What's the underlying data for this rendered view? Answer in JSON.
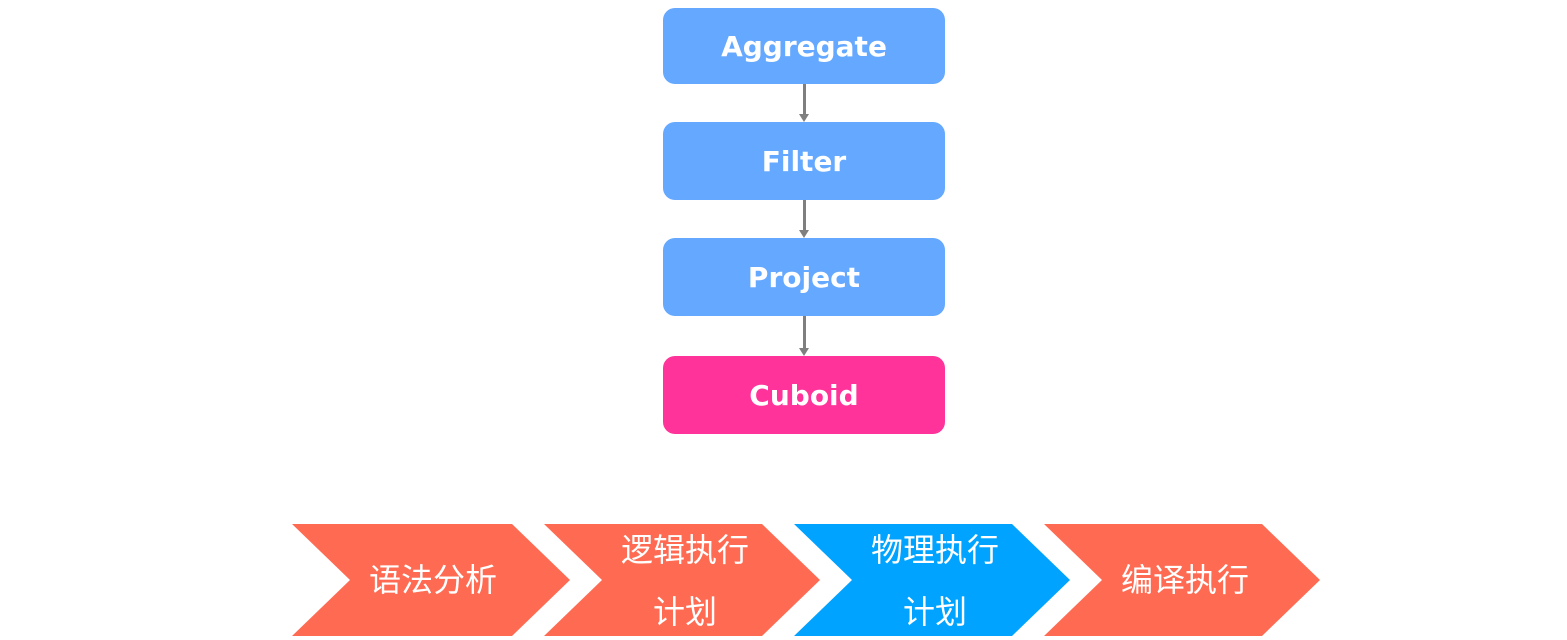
{
  "flow": {
    "nodes": [
      {
        "label": "Aggregate",
        "color": "#64A8FF"
      },
      {
        "label": "Filter",
        "color": "#64A8FF"
      },
      {
        "label": "Project",
        "color": "#64A8FF"
      },
      {
        "label": "Cuboid",
        "color": "#FF3399"
      }
    ]
  },
  "pipeline": {
    "steps": [
      {
        "line1": "语法分析",
        "line2": "",
        "color": "#FF6B52"
      },
      {
        "line1": "逻辑执行",
        "line2": "计划",
        "color": "#FF6B52"
      },
      {
        "line1": "物理执行",
        "line2": "计划",
        "color": "#00A3FF"
      },
      {
        "line1": "编译执行",
        "line2": "",
        "color": "#FF6B52"
      }
    ]
  }
}
